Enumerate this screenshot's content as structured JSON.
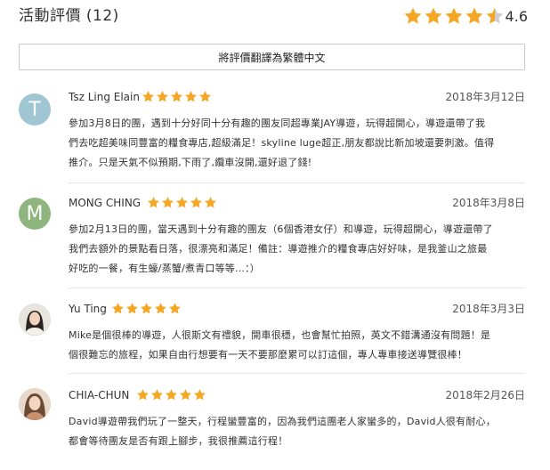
{
  "header": {
    "title": "活動評價 (12)",
    "rating": "4.6",
    "rating_value": 4.6,
    "star_color": "#f5a623"
  },
  "translate_button": {
    "label": "將評價翻譯為繁體中文"
  },
  "reviews": [
    {
      "name": "Tsz Ling Elain",
      "initial": "T",
      "avatar_color": "#9fc6d2",
      "stars": 5,
      "date": "2018年3月12日",
      "lines": [
        "參加3月8日的團，遇到十分好同十分有趣的團友同超專業JAY導遊，玩得超開心，導遊還帶了我",
        "們去吃超美味同豐富的糧食專店,超級滿足！skyline luge超正,朋友都說比新加坡還要刺激。值得",
        "推介。只是天氣不似預期,下雨了,纜車沒開,還好退了錢!"
      ]
    },
    {
      "name": "MONG CHING",
      "initial": "M",
      "avatar_color": "#8fb57f",
      "stars": 5,
      "date": "2018年3月8日",
      "lines": [
        "參加2月13日的團，當天遇到十分有趣的團友（6個香港女仔）和導遊，玩得超開心，導遊還帶了",
        "我們去額外的景點看日落，很漂亮和滿足！備註：導遊推介的糧食專店好好味，是我釜山之旅最",
        "好吃的一餐，有生蠔/蒸蟹/煮青口等等...：）"
      ]
    },
    {
      "name": "Yu Ting",
      "initial": "",
      "avatar_color": "#d9d4ce",
      "stars": 5,
      "date": "2018年3月3日",
      "lines": [
        "Mike是個很棒的導遊，人很斯文有禮貌，開車很穩，也會幫忙拍照，英文不錯溝通沒有問題！是",
        "個很難忘的旅程，如果自由行想要有一天不要那麼累可以訂這個，專人專車接送導覽很棒！"
      ]
    },
    {
      "name": "CHIA-CHUN",
      "initial": "",
      "avatar_color": "#e3c8b4",
      "stars": 5,
      "date": "2018年2月26日",
      "lines": [
        "David導遊帶我們玩了一整天，行程蠻豐富的，因為我們這團老人家蠻多的，David人很有耐心，",
        "都會等待團友是否有跟上腳步，我很推薦這行程！"
      ]
    }
  ]
}
